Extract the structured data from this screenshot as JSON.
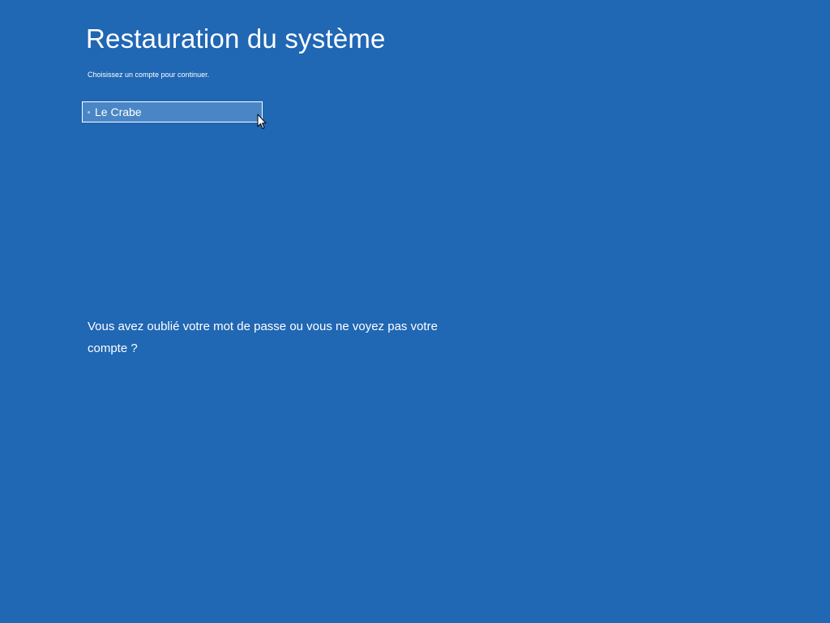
{
  "page": {
    "title": "Restauration du système",
    "subtitle": "Choisissez un compte pour continuer."
  },
  "accounts": [
    {
      "label": "Le Crabe"
    }
  ],
  "help": {
    "link_text": "Vous avez oublié votre mot de passe ou vous ne voyez pas votre compte ?"
  },
  "colors": {
    "background": "#2067b4",
    "selected_item": "#4a86c5",
    "text": "#ffffff"
  }
}
